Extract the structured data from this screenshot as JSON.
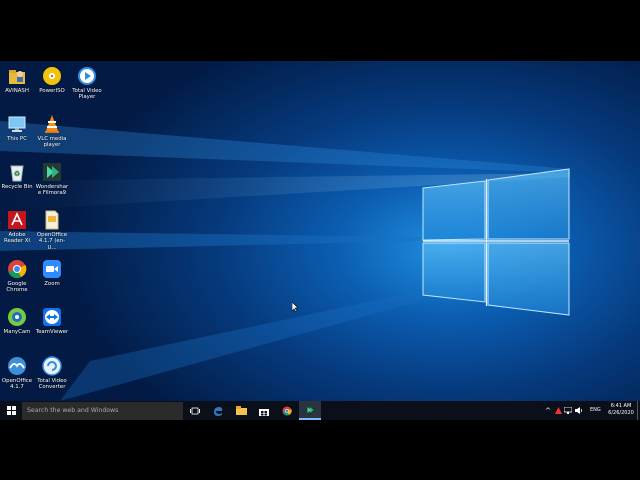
{
  "desktop": {
    "icons": [
      {
        "label": "AVINASH",
        "icon": "user-folder-icon"
      },
      {
        "label": "PowerISO",
        "icon": "poweriso-disc-icon"
      },
      {
        "label": "Total Video Player",
        "icon": "total-video-player-icon"
      },
      {
        "label": "This PC",
        "icon": "this-pc-icon"
      },
      {
        "label": "VLC media player",
        "icon": "vlc-cone-icon"
      },
      {
        "label": "Recycle Bin",
        "icon": "recycle-bin-icon"
      },
      {
        "label": "Wondershare Filmora9",
        "icon": "filmora-icon"
      },
      {
        "label": "Adobe Reader XI",
        "icon": "adobe-reader-icon"
      },
      {
        "label": "OpenOffice 4.1.7 (en-U...",
        "icon": "openoffice-document-icon"
      },
      {
        "label": "Google Chrome",
        "icon": "chrome-icon"
      },
      {
        "label": "Zoom",
        "icon": "zoom-icon"
      },
      {
        "label": "ManyCam",
        "icon": "manycam-icon"
      },
      {
        "label": "TeamViewer",
        "icon": "teamviewer-icon"
      },
      {
        "label": "OpenOffice 4.1.7",
        "icon": "openoffice-gulls-icon"
      },
      {
        "label": "Total Video Converter",
        "icon": "total-video-converter-icon"
      }
    ]
  },
  "taskbar": {
    "search_placeholder": "Search the web and Windows",
    "pinned": [
      "task-view-icon",
      "edge-icon",
      "file-explorer-icon",
      "store-icon",
      "chrome-icon",
      "filmora-icon"
    ],
    "tray": {
      "language": "ENG",
      "time": "6:41 AM",
      "date": "6/26/2020"
    }
  },
  "colors": {
    "taskbar": "#0a0f1a",
    "wallpaper_blue": "#0b5cb0",
    "search_box": "#2b2b2b"
  }
}
